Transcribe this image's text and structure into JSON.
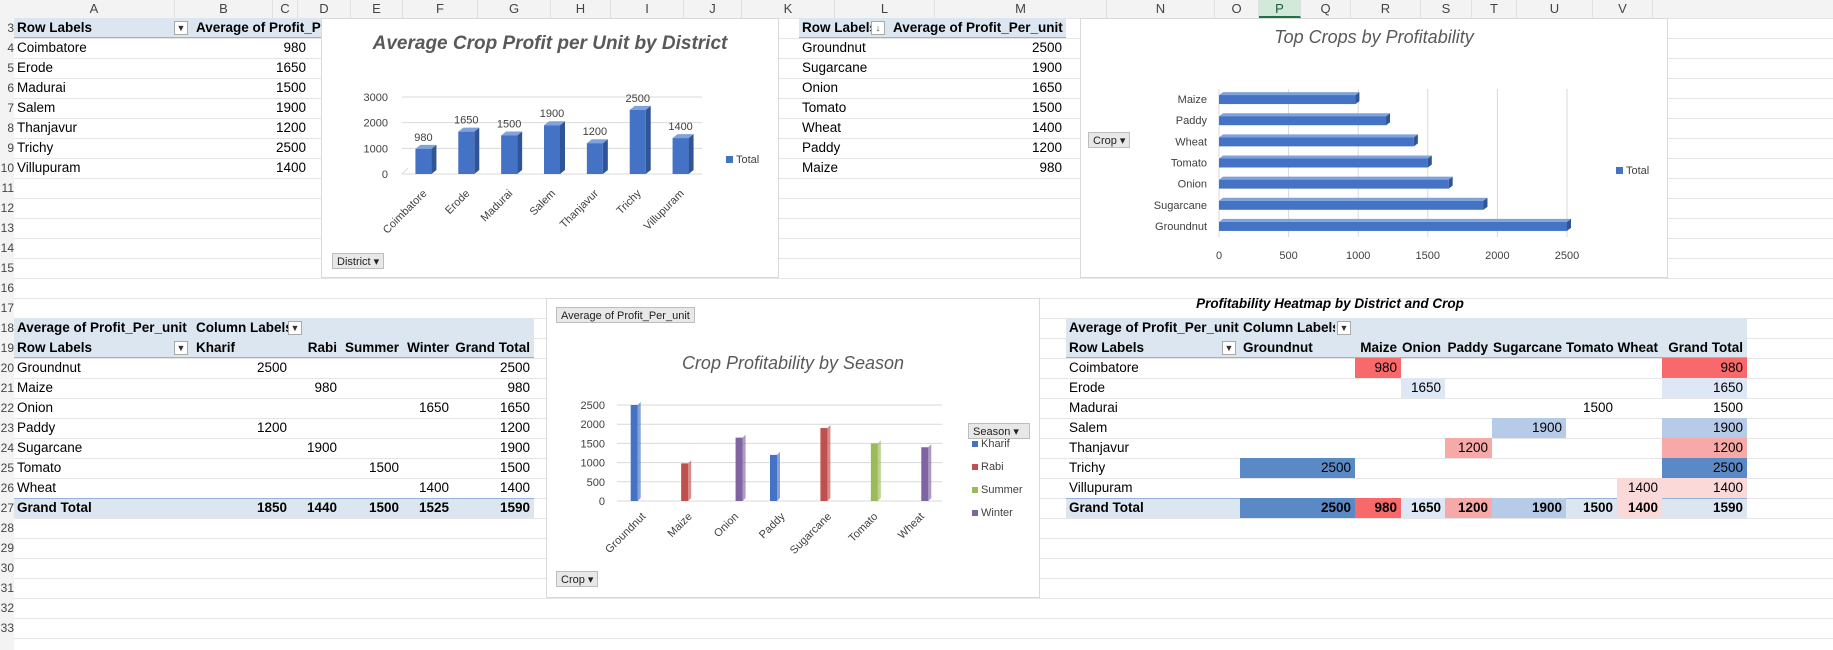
{
  "columns": [
    "A",
    "B",
    "C",
    "D",
    "E",
    "F",
    "G",
    "H",
    "I",
    "J",
    "K",
    "L",
    "M",
    "N",
    "O",
    "P",
    "Q",
    "R",
    "S",
    "T",
    "U",
    "V"
  ],
  "rows": [
    "3",
    "4",
    "5",
    "6",
    "7",
    "8",
    "9",
    "10",
    "11",
    "12",
    "13",
    "14",
    "15",
    "16",
    "17",
    "18",
    "19",
    "20",
    "21",
    "22",
    "23",
    "24",
    "25",
    "26",
    "27",
    "28",
    "29",
    "30",
    "31",
    "32",
    "33"
  ],
  "pivot_district": {
    "row_labels": "Row Labels",
    "value_header": "Average of Profit_Pe",
    "rows": [
      {
        "label": "Coimbatore",
        "value": "980"
      },
      {
        "label": "Erode",
        "value": "1650"
      },
      {
        "label": "Madurai",
        "value": "1500"
      },
      {
        "label": "Salem",
        "value": "1900"
      },
      {
        "label": "Thanjavur",
        "value": "1200"
      },
      {
        "label": "Trichy",
        "value": "2500"
      },
      {
        "label": "Villupuram",
        "value": "1400"
      }
    ]
  },
  "pivot_crop": {
    "row_labels": "Row Labels",
    "value_header": "Average of Profit_Per_unit",
    "rows": [
      {
        "label": "Groundnut",
        "value": "2500"
      },
      {
        "label": "Sugarcane",
        "value": "1900"
      },
      {
        "label": "Onion",
        "value": "1650"
      },
      {
        "label": "Tomato",
        "value": "1500"
      },
      {
        "label": "Wheat",
        "value": "1400"
      },
      {
        "label": "Paddy",
        "value": "1200"
      },
      {
        "label": "Maize",
        "value": "980"
      }
    ]
  },
  "pivot_season": {
    "value_field": "Average of Profit_Per_unit",
    "column_labels": "Column Labels",
    "row_labels": "Row Labels",
    "headers": [
      "Kharif",
      "Rabi",
      "Summer",
      "Winter",
      "Grand Total"
    ],
    "rows": [
      {
        "label": "Groundnut",
        "cells": [
          "2500",
          "",
          "",
          "",
          "2500"
        ]
      },
      {
        "label": "Maize",
        "cells": [
          "",
          "980",
          "",
          "",
          "980"
        ]
      },
      {
        "label": "Onion",
        "cells": [
          "",
          "",
          "",
          "1650",
          "1650"
        ]
      },
      {
        "label": "Paddy",
        "cells": [
          "1200",
          "",
          "",
          "",
          "1200"
        ]
      },
      {
        "label": "Sugarcane",
        "cells": [
          "",
          "1900",
          "",
          "",
          "1900"
        ]
      },
      {
        "label": "Tomato",
        "cells": [
          "",
          "",
          "1500",
          "",
          "1500"
        ]
      },
      {
        "label": "Wheat",
        "cells": [
          "",
          "",
          "",
          "1400",
          "1400"
        ]
      }
    ],
    "total": {
      "label": "Grand Total",
      "cells": [
        "1850",
        "1440",
        "1500",
        "1525",
        "1590"
      ]
    }
  },
  "heatmap": {
    "title": "Profitability Heatmap by District and Crop",
    "value_field": "Average of Profit_Per_unit",
    "column_labels": "Column Labels",
    "row_labels": "Row Labels",
    "headers": [
      "Groundnut",
      "Maize",
      "Onion",
      "Paddy",
      "Sugarcane",
      "Tomato",
      "Wheat",
      "Grand Total"
    ],
    "rows": [
      {
        "label": "Coimbatore",
        "cells": [
          "",
          "980",
          "",
          "",
          "",
          "",
          "",
          "980"
        ]
      },
      {
        "label": "Erode",
        "cells": [
          "",
          "",
          "1650",
          "",
          "",
          "",
          "",
          "1650"
        ]
      },
      {
        "label": "Madurai",
        "cells": [
          "",
          "",
          "",
          "",
          "",
          "1500",
          "",
          "1500"
        ]
      },
      {
        "label": "Salem",
        "cells": [
          "",
          "",
          "",
          "",
          "1900",
          "",
          "",
          "1900"
        ]
      },
      {
        "label": "Thanjavur",
        "cells": [
          "",
          "",
          "",
          "1200",
          "",
          "",
          "",
          "1200"
        ]
      },
      {
        "label": "Trichy",
        "cells": [
          "2500",
          "",
          "",
          "",
          "",
          "",
          "",
          "2500"
        ]
      },
      {
        "label": "Villupuram",
        "cells": [
          "",
          "",
          "",
          "",
          "",
          "",
          "1400",
          "1400"
        ]
      }
    ],
    "total": {
      "label": "Grand Total",
      "cells": [
        "2500",
        "980",
        "1650",
        "1200",
        "1900",
        "1500",
        "1400",
        "1590"
      ]
    },
    "colors": {
      "high": "#5a8ac6",
      "low": "#f8696b"
    }
  },
  "chart_data": [
    {
      "type": "bar",
      "title": "Average Crop Profit per Unit by District",
      "categories": [
        "Coimbatore",
        "Erode",
        "Madurai",
        "Salem",
        "Thanjavur",
        "Trichy",
        "Villupuram"
      ],
      "values": [
        980,
        1650,
        1500,
        1900,
        1200,
        2500,
        1400
      ],
      "series": [
        {
          "name": "Total",
          "values": [
            980,
            1650,
            1500,
            1900,
            1200,
            2500,
            1400
          ]
        }
      ],
      "yticks": [
        "0",
        "1000",
        "2000",
        "3000"
      ],
      "ylim": [
        0,
        3000
      ],
      "legend": "right",
      "filter_button": "District",
      "color": "#4472c4"
    },
    {
      "type": "bar",
      "orientation": "horizontal",
      "title": "Top Crops by Profitability",
      "categories": [
        "Maize",
        "Paddy",
        "Wheat",
        "Tomato",
        "Onion",
        "Sugarcane",
        "Groundnut"
      ],
      "values": [
        980,
        1200,
        1400,
        1500,
        1650,
        1900,
        2500
      ],
      "series": [
        {
          "name": "Total",
          "values": [
            980,
            1200,
            1400,
            1500,
            1650,
            1900,
            2500
          ]
        }
      ],
      "xticks": [
        "0",
        "500",
        "1000",
        "1500",
        "2000",
        "2500"
      ],
      "xlim": [
        0,
        2500
      ],
      "legend": "right",
      "filter_button": "Crop",
      "color": "#4472c4"
    },
    {
      "type": "bar",
      "title": "Crop Profitability by Season",
      "categories": [
        "Groundnut",
        "Maize",
        "Onion",
        "Paddy",
        "Sugarcane",
        "Tomato",
        "Wheat"
      ],
      "series": [
        {
          "name": "Kharif",
          "values": [
            2500,
            null,
            null,
            1200,
            null,
            null,
            null
          ]
        },
        {
          "name": "Rabi",
          "values": [
            null,
            980,
            null,
            null,
            1900,
            null,
            null
          ]
        },
        {
          "name": "Summer",
          "values": [
            null,
            null,
            null,
            null,
            null,
            1500,
            null
          ]
        },
        {
          "name": "Winter",
          "values": [
            null,
            null,
            1650,
            null,
            null,
            null,
            1400
          ]
        }
      ],
      "yticks": [
        "0",
        "500",
        "1000",
        "1500",
        "2000",
        "2500"
      ],
      "ylim": [
        0,
        2500
      ],
      "legend": "right",
      "legend_title": "Season",
      "value_button": "Average of Profit_Per_unit",
      "filter_button": "Crop",
      "colors": {
        "Kharif": "#4472c4",
        "Rabi": "#c0504d",
        "Summer": "#9bbb59",
        "Winter": "#8064a2"
      }
    }
  ]
}
